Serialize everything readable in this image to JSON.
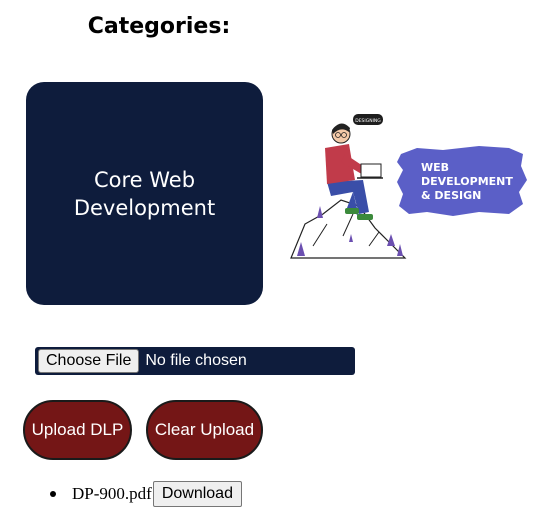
{
  "header": {
    "title": "Categories:"
  },
  "categories": [
    {
      "label": "Core Web\nDevelopment",
      "background": "#0e1c3c"
    }
  ],
  "illustration": {
    "badge_line1": "WEB",
    "badge_line2": "DEVELOPMENT",
    "badge_line3": "& DESIGN",
    "speech_text": "DESIGNING",
    "badge_color": "#5b5fc7"
  },
  "upload": {
    "choose_label": "Choose File",
    "status": "No file chosen",
    "upload_label": "Upload DLP",
    "clear_label": "Clear Upload",
    "button_color": "#741616"
  },
  "files": [
    {
      "name": "DP-900.pdf",
      "download_label": "Download"
    }
  ]
}
